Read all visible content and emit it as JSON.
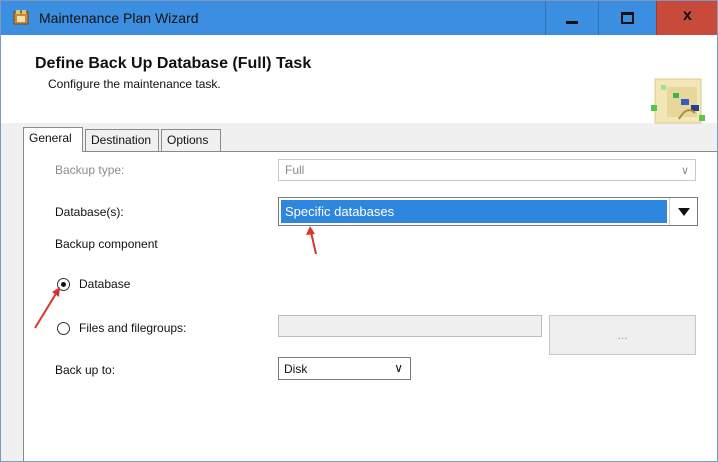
{
  "window": {
    "title": "Maintenance Plan Wizard",
    "close_label": "x"
  },
  "header": {
    "title": "Define Back Up Database (Full) Task",
    "subtitle": "Configure the maintenance task."
  },
  "tabs": [
    {
      "label": "General",
      "active": true
    },
    {
      "label": "Destination",
      "active": false
    },
    {
      "label": "Options",
      "active": false
    }
  ],
  "form": {
    "backup_type_label": "Backup type:",
    "backup_type_value": "Full",
    "databases_label": "Database(s):",
    "databases_value": "Specific databases",
    "backup_component_label": "Backup component",
    "radio_database_label": "Database",
    "radio_files_label": "Files and filegroups:",
    "browse_label": "...",
    "back_up_to_label": "Back up to:",
    "back_up_to_value": "Disk"
  },
  "colors": {
    "titlebar": "#3c8fe0",
    "close_button": "#c74a3a",
    "selection": "#2f86de",
    "annotation_arrow": "#d9342b"
  }
}
